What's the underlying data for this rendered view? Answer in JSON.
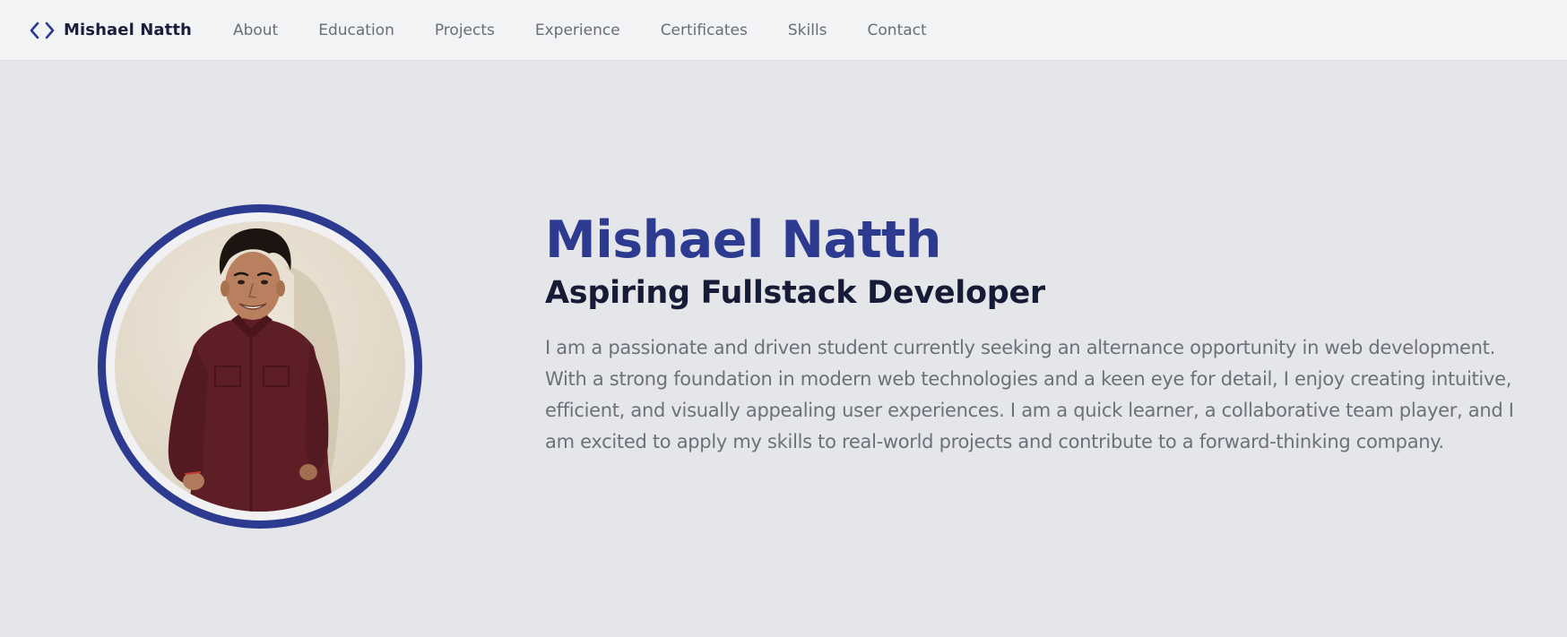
{
  "nav": {
    "brand_icon": "code-brackets-icon",
    "brand_name": "Mishael Natth",
    "links": [
      "About",
      "Education",
      "Projects",
      "Experience",
      "Certificates",
      "Skills",
      "Contact"
    ]
  },
  "hero": {
    "name": "Mishael Natth",
    "role": "Aspiring Fullstack Developer",
    "bio": "I am a passionate and driven student currently seeking an alternance opportunity in web development. With a strong foundation in modern web technologies and a keen eye for detail, I enjoy creating intuitive, efficient, and visually appealing user experiences. I am a quick learner, a collaborative team player, and I am excited to apply my skills to real-world projects and contribute to a forward-thinking company."
  },
  "colors": {
    "accent": "#2c3b8f",
    "nav_background": "#f2f3f5",
    "page_background": "#e5e6ea",
    "heading_dark": "#161b36",
    "body_text": "#6e7079",
    "shirt": "#5e1e26"
  }
}
